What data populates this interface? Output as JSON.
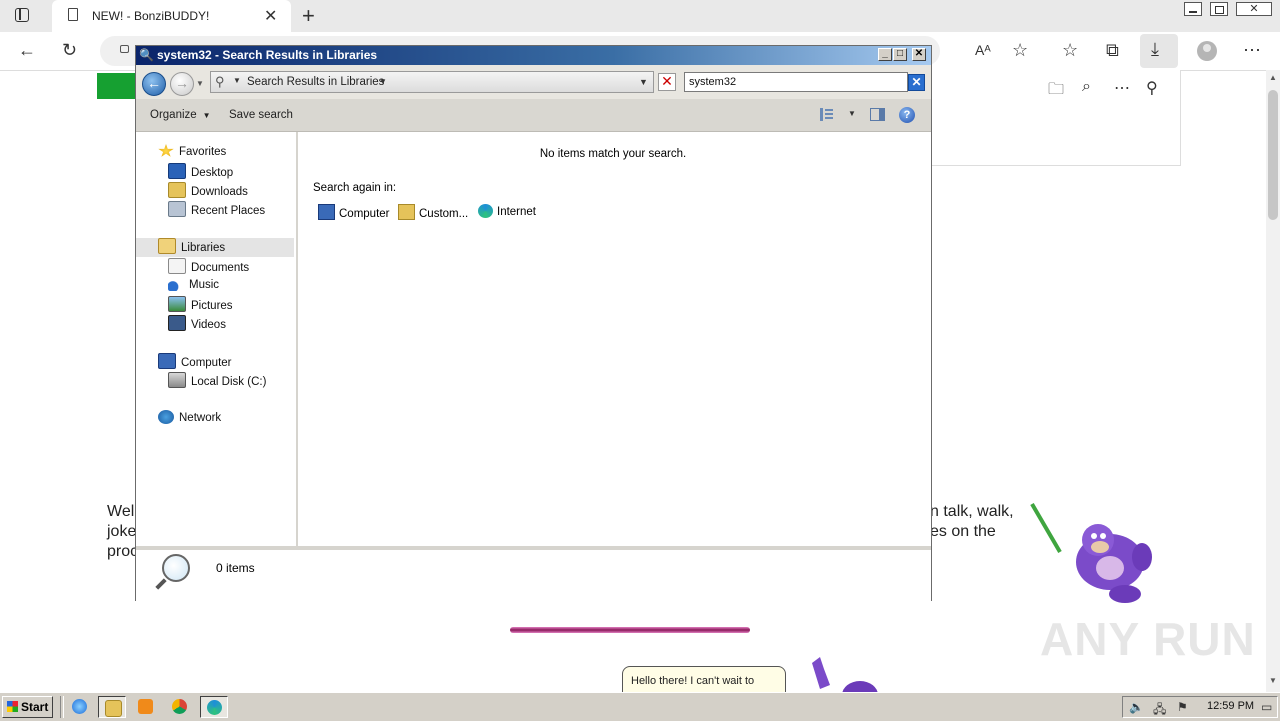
{
  "browser": {
    "tab_title": "NEW! - BonziBUDDY!",
    "tab_close": "✕",
    "new_tab": "+"
  },
  "explorer": {
    "title": "system32 - Search Results in Libraries",
    "address_crumb": "Search Results in Libraries",
    "search_value": "system32",
    "commands": {
      "organize": "Organize",
      "save_search": "Save search"
    },
    "nav": {
      "favorites": "Favorites",
      "desktop": "Desktop",
      "downloads": "Downloads",
      "recent_places": "Recent Places",
      "libraries": "Libraries",
      "documents": "Documents",
      "music": "Music",
      "pictures": "Pictures",
      "videos": "Videos",
      "computer": "Computer",
      "local_disk": "Local Disk (C:)",
      "network": "Network"
    },
    "content": {
      "no_items": "No items match your search.",
      "search_again": "Search again in:",
      "targets": {
        "computer": "Computer",
        "custom": "Custom...",
        "internet": "Internet"
      }
    },
    "details": {
      "count": "0 items"
    }
  },
  "page": {
    "welcome_left_1": "Wel",
    "welcome_left_2": "joke",
    "welcome_left_3": "proc",
    "welcome_right_1": "n talk, walk,",
    "welcome_right_2": "es on the",
    "speech": "Hello there! I can't wait to",
    "watermark": "ANY RUN"
  },
  "taskbar": {
    "start": "Start",
    "clock": "12:59 PM"
  },
  "colors": {
    "titlebar": "#0a246a",
    "taskbar": "#d4d0c8",
    "accent_green": "#16a031"
  }
}
